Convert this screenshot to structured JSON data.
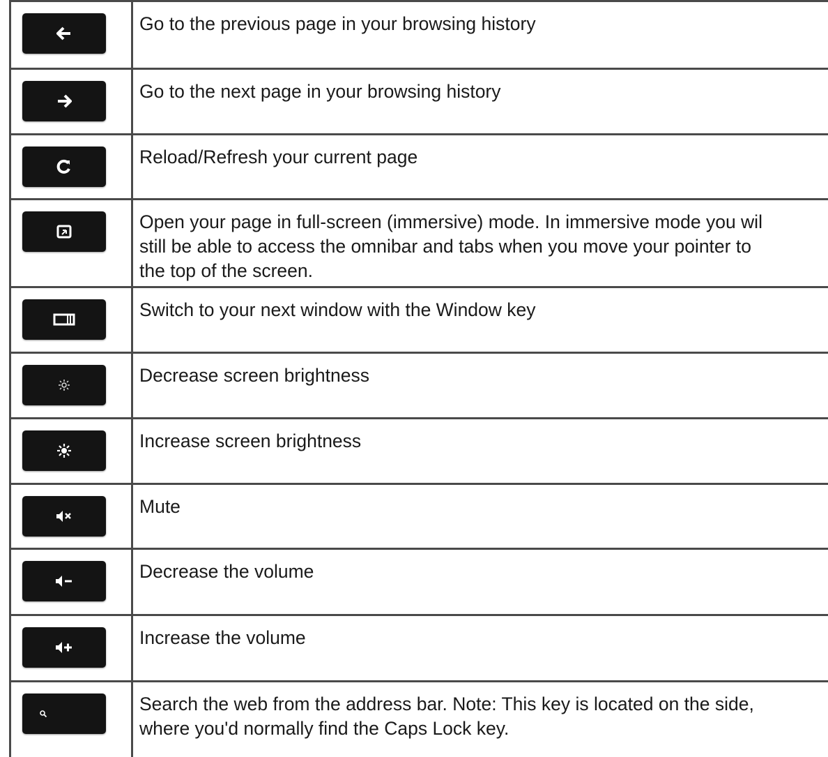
{
  "rows": [
    {
      "icon": "back-arrow-icon",
      "desc": "Go to the previous page in your browsing history"
    },
    {
      "icon": "forward-arrow-icon",
      "desc": "Go to the next page in your browsing history"
    },
    {
      "icon": "reload-icon",
      "desc": "Reload/Refresh your current page"
    },
    {
      "icon": "fullscreen-icon",
      "desc": "Open your page in full-screen (immersive) mode. In immersive mode you wil\nstill be able to access the omnibar and tabs when you move your pointer to\nthe top of the screen."
    },
    {
      "icon": "switch-window-icon",
      "desc": "Switch to your next window with the Window key"
    },
    {
      "icon": "brightness-down-icon",
      "desc": "Decrease screen brightness"
    },
    {
      "icon": "brightness-up-icon",
      "desc": "Increase screen brightness"
    },
    {
      "icon": "mute-icon",
      "desc": "Mute"
    },
    {
      "icon": "volume-down-icon",
      "desc": "Decrease the volume"
    },
    {
      "icon": "volume-up-icon",
      "desc": "Increase the volume"
    },
    {
      "icon": "search-icon",
      "desc": "Search the web from the address bar. Note: This key is located on the side,\nwhere you'd normally find the Caps Lock key."
    }
  ]
}
